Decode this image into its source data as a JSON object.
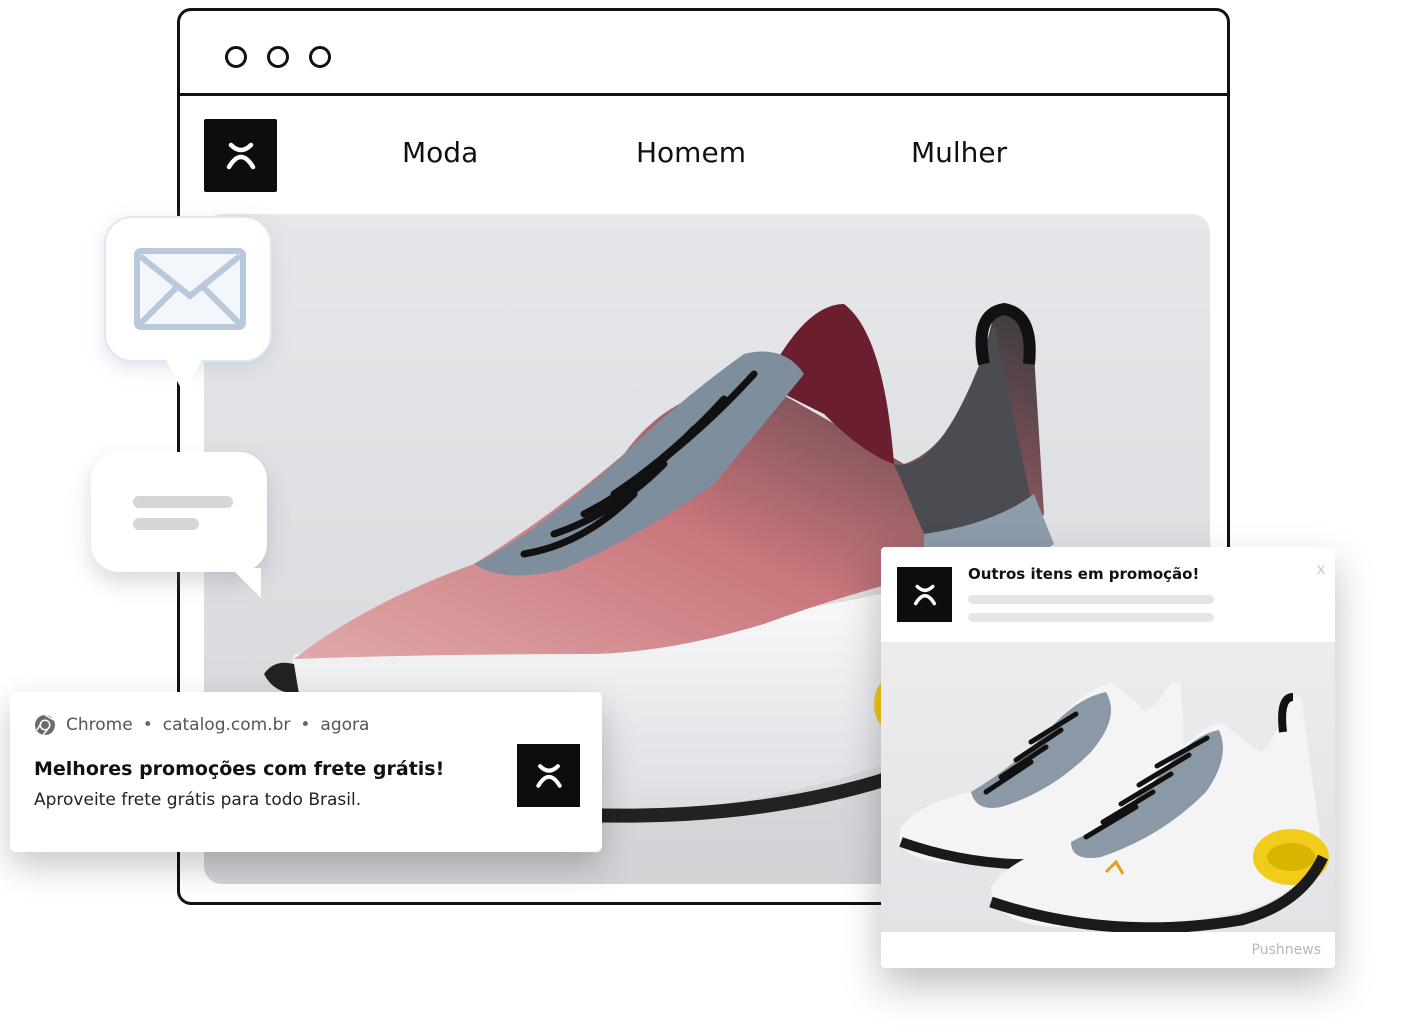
{
  "nav": {
    "items": [
      "Moda",
      "Homem",
      "Mulher"
    ]
  },
  "notification": {
    "app": "Chrome",
    "site": "catalog.com.br",
    "time": "agora",
    "separator": "•",
    "title": "Melhores promoções com frete grátis!",
    "body": "Aproveite frete grátis para todo Brasil."
  },
  "popup": {
    "title": "Outros itens em promoção!",
    "close": "x",
    "brand": "Pushnews"
  },
  "colors": {
    "logo_bg": "#0d0d0d",
    "accent_yellow": "#f2cc1b",
    "shoe_pink": "#c9777c",
    "shoe_blue_gray": "#7e8e9c",
    "shoe_burgundy": "#6b1e2e"
  },
  "icons": [
    "mail-icon",
    "chat-icon",
    "chrome-icon",
    "brand-logo-icon"
  ]
}
